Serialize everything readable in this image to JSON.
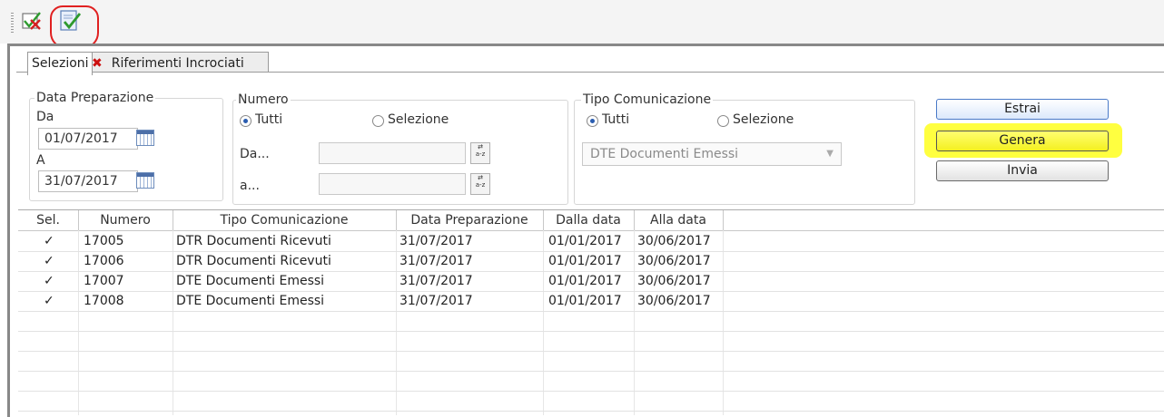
{
  "toolbar": {
    "icons": [
      "deselect-check-icon",
      "document-check-icon"
    ]
  },
  "tabs": [
    {
      "label": "Selezioni",
      "active": true
    },
    {
      "label": "Riferimenti Incrociati",
      "icon": "red-x-icon",
      "active": false
    }
  ],
  "data_preparazione": {
    "title": "Data Preparazione",
    "from_label": "Da",
    "from_value": "01/07/2017",
    "to_label": "A",
    "to_value": "31/07/2017"
  },
  "numero": {
    "title": "Numero",
    "option_all": "Tutti",
    "option_select": "Selezione",
    "selected": "Tutti",
    "from_label": "Da...",
    "to_label": "a...",
    "from_value": "",
    "to_value": "",
    "az_label": "a-z"
  },
  "tipo_comunicazione": {
    "title": "Tipo Comunicazione",
    "option_all": "Tutti",
    "option_select": "Selezione",
    "selected": "Tutti",
    "dropdown_value": "DTE Documenti Emessi"
  },
  "buttons": {
    "estrai": "Estrai",
    "genera": "Genera",
    "invia": "Invia"
  },
  "grid": {
    "columns": [
      "Sel.",
      "Numero",
      "Tipo Comunicazione",
      "Data Preparazione",
      "Dalla data",
      "Alla data"
    ],
    "rows": [
      {
        "sel": "✓",
        "numero": "17005",
        "tipo": "DTR Documenti Ricevuti",
        "data_prep": "31/07/2017",
        "dalla": "01/01/2017",
        "alla": "30/06/2017"
      },
      {
        "sel": "✓",
        "numero": "17006",
        "tipo": "DTR Documenti Ricevuti",
        "data_prep": "31/07/2017",
        "dalla": "01/01/2017",
        "alla": "30/06/2017"
      },
      {
        "sel": "✓",
        "numero": "17007",
        "tipo": "DTE Documenti Emessi",
        "data_prep": "31/07/2017",
        "dalla": "01/01/2017",
        "alla": "30/06/2017"
      },
      {
        "sel": "✓",
        "numero": "17008",
        "tipo": "DTE Documenti Emessi",
        "data_prep": "31/07/2017",
        "dalla": "01/01/2017",
        "alla": "30/06/2017"
      }
    ]
  },
  "colors": {
    "highlight": "#ffff40",
    "annotation_circle": "#e02020",
    "accent_blue": "#4a7ac8"
  }
}
